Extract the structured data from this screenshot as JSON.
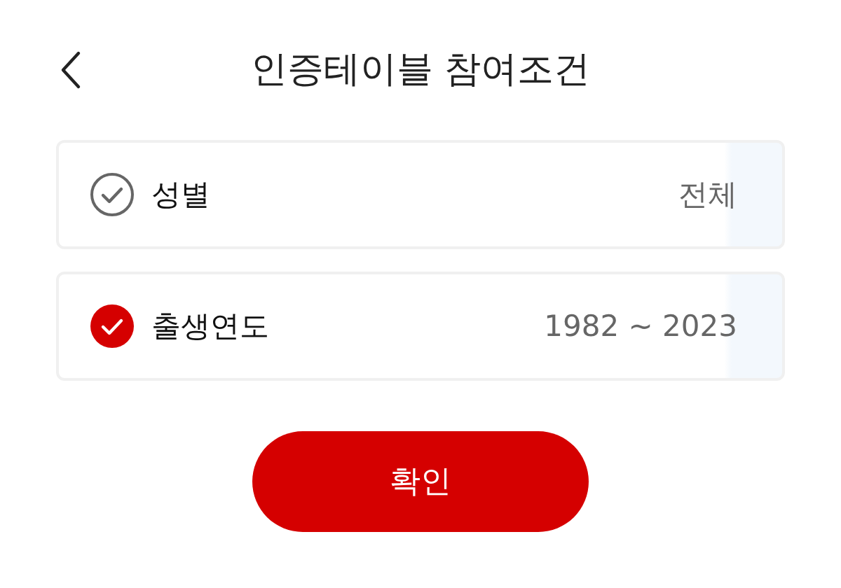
{
  "header": {
    "title": "인증테이블 참여조건"
  },
  "conditions": [
    {
      "label": "성별",
      "value": "전체",
      "checked": false
    },
    {
      "label": "출생연도",
      "value": "1982 ~ 2023",
      "checked": true
    }
  ],
  "confirm_button": {
    "label": "확인"
  }
}
